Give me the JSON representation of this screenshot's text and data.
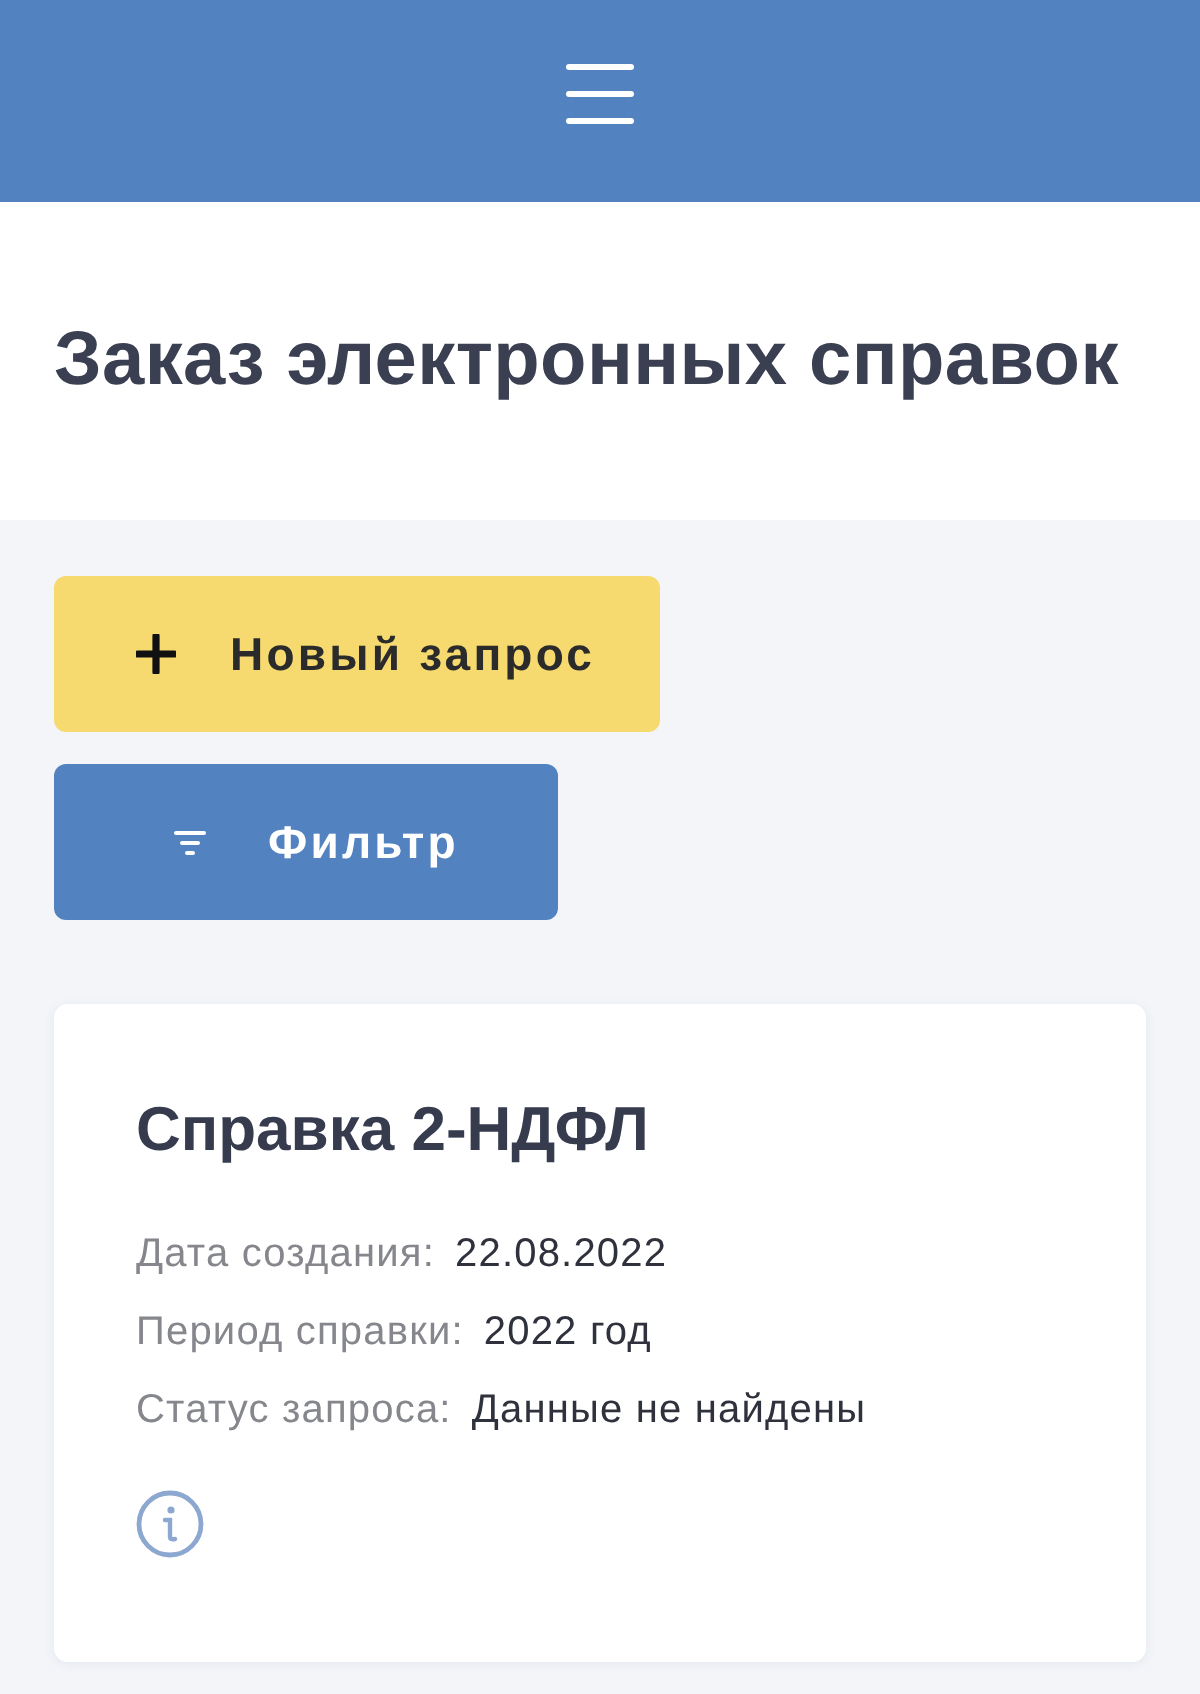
{
  "page_title": "Заказ электронных справок",
  "actions": [
    {
      "kind": "add",
      "label": "Новый запрос"
    },
    {
      "kind": "filter",
      "label": "Фильтр"
    }
  ],
  "requests": [
    {
      "title": "Справка 2-НДФЛ",
      "fields": [
        {
          "label": "Дата создания:",
          "value": "22.08.2022"
        },
        {
          "label": "Период справки:",
          "value": "2022 год"
        },
        {
          "label": "Статус запроса:",
          "value": "Данные не найдены"
        }
      ]
    }
  ]
}
